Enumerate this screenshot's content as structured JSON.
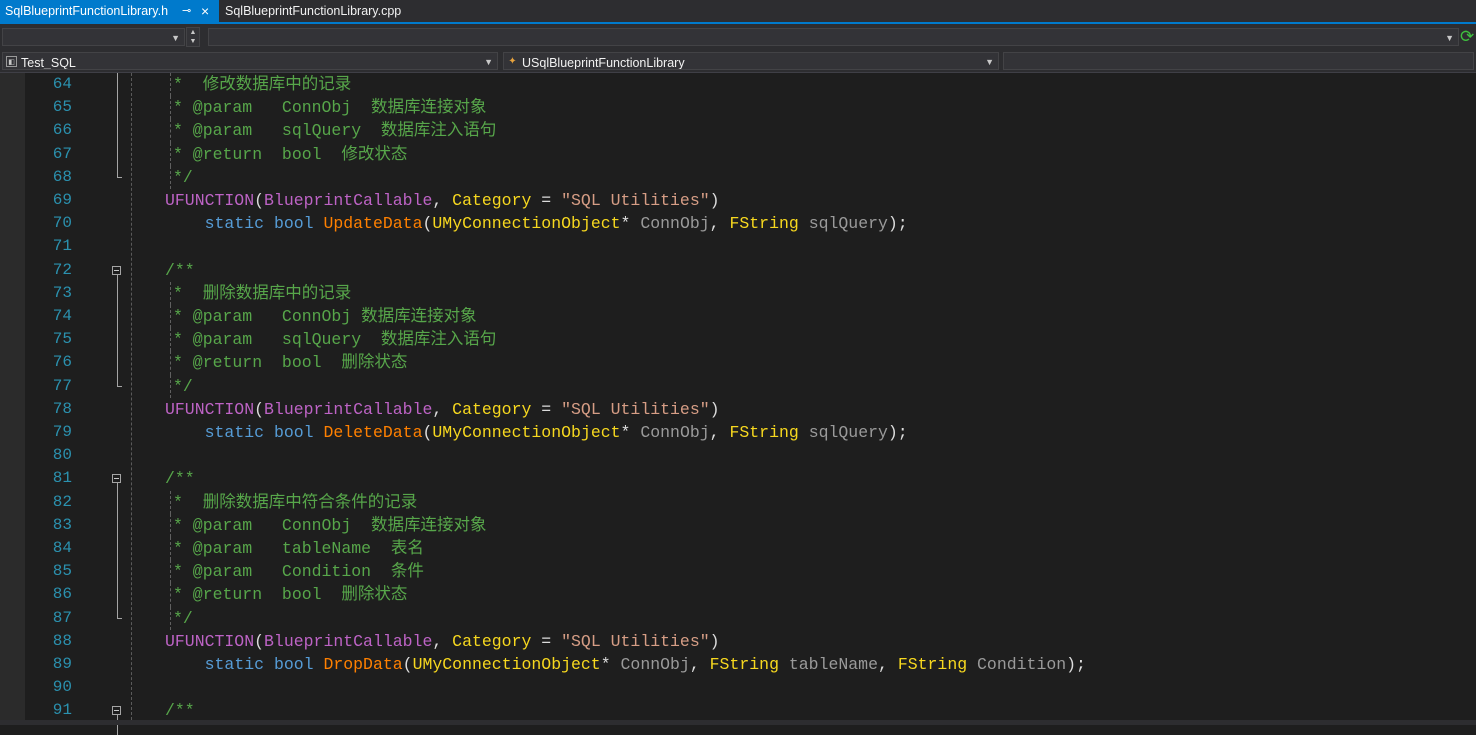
{
  "tabs": {
    "active": {
      "label": "SqlBlueprintFunctionLibrary.h",
      "pin": "⊸",
      "close": "×"
    },
    "inactive": {
      "label": "SqlBlueprintFunctionLibrary.cpp"
    }
  },
  "nav": {
    "top_left_value": "",
    "top_right_value": "",
    "project": "Test_SQL",
    "scope": "USqlBlueprintFunctionLibrary",
    "member": ""
  },
  "code": {
    "lines": [
      {
        "n": "64",
        "tokens": [
          [
            "c-comment",
            "*  修改数据库中的记录"
          ]
        ]
      },
      {
        "n": "65",
        "tokens": [
          [
            "c-comment",
            "* @param   ConnObj  数据库连接对象"
          ]
        ]
      },
      {
        "n": "66",
        "tokens": [
          [
            "c-comment",
            "* @param   sqlQuery  数据库注入语句"
          ]
        ]
      },
      {
        "n": "67",
        "tokens": [
          [
            "c-comment",
            "* @return  bool  修改状态"
          ]
        ]
      },
      {
        "n": "68",
        "tokens": [
          [
            "c-comment",
            "*/"
          ]
        ]
      },
      {
        "n": "69",
        "tokens": [
          [
            "c-macro",
            "UFUNCTION"
          ],
          [
            "c-plain",
            "("
          ],
          [
            "c-macro",
            "BlueprintCallable"
          ],
          [
            "c-plain",
            ", "
          ],
          [
            "c-type",
            "Category"
          ],
          [
            "c-plain",
            " = "
          ],
          [
            "c-str",
            "\"SQL Utilities\""
          ],
          [
            "c-plain",
            ")"
          ]
        ]
      },
      {
        "n": "70",
        "tokens": [
          [
            "c-plain",
            "    "
          ],
          [
            "c-kw",
            "static"
          ],
          [
            "c-plain",
            " "
          ],
          [
            "c-kw",
            "bool"
          ],
          [
            "c-plain",
            " "
          ],
          [
            "c-func",
            "UpdateData"
          ],
          [
            "c-plain",
            "("
          ],
          [
            "c-type",
            "UMyConnectionObject"
          ],
          [
            "c-plain",
            "* "
          ],
          [
            "c-param",
            "ConnObj"
          ],
          [
            "c-plain",
            ", "
          ],
          [
            "c-type",
            "FString"
          ],
          [
            "c-plain",
            " "
          ],
          [
            "c-param",
            "sqlQuery"
          ],
          [
            "c-plain",
            ");"
          ]
        ]
      },
      {
        "n": "71",
        "tokens": []
      },
      {
        "n": "72",
        "tokens": [
          [
            "c-comment",
            "/**"
          ]
        ]
      },
      {
        "n": "73",
        "tokens": [
          [
            "c-comment",
            "*  删除数据库中的记录"
          ]
        ]
      },
      {
        "n": "74",
        "tokens": [
          [
            "c-comment",
            "* @param   ConnObj 数据库连接对象"
          ]
        ]
      },
      {
        "n": "75",
        "tokens": [
          [
            "c-comment",
            "* @param   sqlQuery  数据库注入语句"
          ]
        ]
      },
      {
        "n": "76",
        "tokens": [
          [
            "c-comment",
            "* @return  bool  删除状态"
          ]
        ]
      },
      {
        "n": "77",
        "tokens": [
          [
            "c-comment",
            "*/"
          ]
        ]
      },
      {
        "n": "78",
        "tokens": [
          [
            "c-macro",
            "UFUNCTION"
          ],
          [
            "c-plain",
            "("
          ],
          [
            "c-macro",
            "BlueprintCallable"
          ],
          [
            "c-plain",
            ", "
          ],
          [
            "c-type",
            "Category"
          ],
          [
            "c-plain",
            " = "
          ],
          [
            "c-str",
            "\"SQL Utilities\""
          ],
          [
            "c-plain",
            ")"
          ]
        ]
      },
      {
        "n": "79",
        "tokens": [
          [
            "c-plain",
            "    "
          ],
          [
            "c-kw",
            "static"
          ],
          [
            "c-plain",
            " "
          ],
          [
            "c-kw",
            "bool"
          ],
          [
            "c-plain",
            " "
          ],
          [
            "c-func",
            "DeleteData"
          ],
          [
            "c-plain",
            "("
          ],
          [
            "c-type",
            "UMyConnectionObject"
          ],
          [
            "c-plain",
            "* "
          ],
          [
            "c-param",
            "ConnObj"
          ],
          [
            "c-plain",
            ", "
          ],
          [
            "c-type",
            "FString"
          ],
          [
            "c-plain",
            " "
          ],
          [
            "c-param",
            "sqlQuery"
          ],
          [
            "c-plain",
            ");"
          ]
        ]
      },
      {
        "n": "80",
        "tokens": []
      },
      {
        "n": "81",
        "tokens": [
          [
            "c-comment",
            "/**"
          ]
        ]
      },
      {
        "n": "82",
        "tokens": [
          [
            "c-comment",
            "*  删除数据库中符合条件的记录"
          ]
        ]
      },
      {
        "n": "83",
        "tokens": [
          [
            "c-comment",
            "* @param   ConnObj  数据库连接对象"
          ]
        ]
      },
      {
        "n": "84",
        "tokens": [
          [
            "c-comment",
            "* @param   tableName  表名"
          ]
        ]
      },
      {
        "n": "85",
        "tokens": [
          [
            "c-comment",
            "* @param   Condition  条件"
          ]
        ]
      },
      {
        "n": "86",
        "tokens": [
          [
            "c-comment",
            "* @return  bool  删除状态"
          ]
        ]
      },
      {
        "n": "87",
        "tokens": [
          [
            "c-comment",
            "*/"
          ]
        ]
      },
      {
        "n": "88",
        "tokens": [
          [
            "c-macro",
            "UFUNCTION"
          ],
          [
            "c-plain",
            "("
          ],
          [
            "c-macro",
            "BlueprintCallable"
          ],
          [
            "c-plain",
            ", "
          ],
          [
            "c-type",
            "Category"
          ],
          [
            "c-plain",
            " = "
          ],
          [
            "c-str",
            "\"SQL Utilities\""
          ],
          [
            "c-plain",
            ")"
          ]
        ]
      },
      {
        "n": "89",
        "tokens": [
          [
            "c-plain",
            "    "
          ],
          [
            "c-kw",
            "static"
          ],
          [
            "c-plain",
            " "
          ],
          [
            "c-kw",
            "bool"
          ],
          [
            "c-plain",
            " "
          ],
          [
            "c-func",
            "DropData"
          ],
          [
            "c-plain",
            "("
          ],
          [
            "c-type",
            "UMyConnectionObject"
          ],
          [
            "c-plain",
            "* "
          ],
          [
            "c-param",
            "ConnObj"
          ],
          [
            "c-plain",
            ", "
          ],
          [
            "c-type",
            "FString"
          ],
          [
            "c-plain",
            " "
          ],
          [
            "c-param",
            "tableName"
          ],
          [
            "c-plain",
            ", "
          ],
          [
            "c-type",
            "FString"
          ],
          [
            "c-plain",
            " "
          ],
          [
            "c-param",
            "Condition"
          ],
          [
            "c-plain",
            ");"
          ]
        ]
      },
      {
        "n": "90",
        "tokens": []
      },
      {
        "n": "91",
        "tokens": [
          [
            "c-comment",
            "/**"
          ]
        ]
      }
    ]
  }
}
